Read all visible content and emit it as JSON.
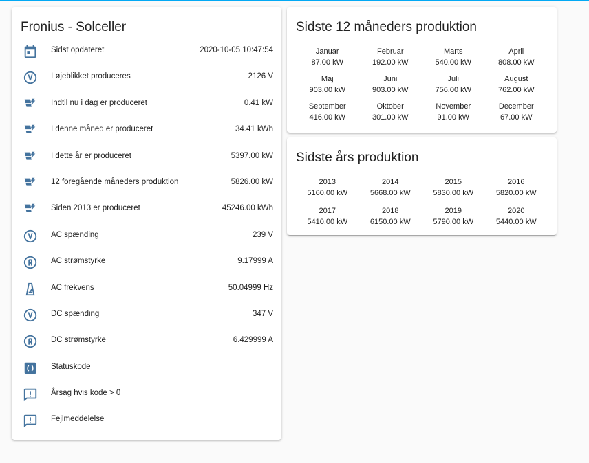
{
  "colors": {
    "icon": "#44739e",
    "accent": "#03a9f4",
    "background": "#fafafa",
    "card": "#ffffff"
  },
  "fronius": {
    "title": "Fronius - Solceller",
    "rows": [
      {
        "icon": "calendar-icon",
        "name": "Sidst opdateret",
        "state": "2020-10-05 10:47:54"
      },
      {
        "icon": "voltage-icon",
        "name": "I øjeblikket produceres",
        "state": "2126 V"
      },
      {
        "icon": "solar-power-icon",
        "name": "Indtil nu i dag er produceret",
        "state": "0.41 kW"
      },
      {
        "icon": "solar-power-icon",
        "name": "I denne måned er produceret",
        "state": "34.41 kWh"
      },
      {
        "icon": "solar-power-icon",
        "name": "I dette år er produceret",
        "state": "5397.00 kW"
      },
      {
        "icon": "solar-power-icon",
        "name": "12 foregående måneders produktion",
        "state": "5826.00 kW"
      },
      {
        "icon": "solar-power-icon",
        "name": "Siden 2013 er produceret",
        "state": "45246.00 kWh"
      },
      {
        "icon": "voltage-icon",
        "name": "AC spænding",
        "state": "239 V"
      },
      {
        "icon": "current-icon",
        "name": "AC strømstyrke",
        "state": "9.17999 A"
      },
      {
        "icon": "metronome-icon",
        "name": "AC frekvens",
        "state": "50.04999 Hz"
      },
      {
        "icon": "voltage-icon",
        "name": "DC spænding",
        "state": "347 V"
      },
      {
        "icon": "current-icon",
        "name": "DC strømstyrke",
        "state": "6.429999 A"
      },
      {
        "icon": "code-parentheses-icon",
        "name": "Statuskode",
        "state": ""
      },
      {
        "icon": "alert-message-icon",
        "name": "Årsag hvis kode > 0",
        "state": ""
      },
      {
        "icon": "alert-message-icon",
        "name": "Fejlmeddelelse",
        "state": ""
      }
    ]
  },
  "months": {
    "title": "Sidste 12 måneders produktion",
    "items": [
      {
        "label": "Januar",
        "value": "87.00 kW"
      },
      {
        "label": "Februar",
        "value": "192.00 kW"
      },
      {
        "label": "Marts",
        "value": "540.00 kW"
      },
      {
        "label": "April",
        "value": "808.00 kW"
      },
      {
        "label": "Maj",
        "value": "903.00 kW"
      },
      {
        "label": "Juni",
        "value": "903.00 kW"
      },
      {
        "label": "Juli",
        "value": "756.00 kW"
      },
      {
        "label": "August",
        "value": "762.00 kW"
      },
      {
        "label": "September",
        "value": "416.00 kW"
      },
      {
        "label": "Oktober",
        "value": "301.00 kW"
      },
      {
        "label": "November",
        "value": "91.00 kW"
      },
      {
        "label": "December",
        "value": "67.00 kW"
      }
    ]
  },
  "years": {
    "title": "Sidste års produktion",
    "items": [
      {
        "label": "2013",
        "value": "5160.00 kW"
      },
      {
        "label": "2014",
        "value": "5668.00 kW"
      },
      {
        "label": "2015",
        "value": "5830.00 kW"
      },
      {
        "label": "2016",
        "value": "5820.00 kW"
      },
      {
        "label": "2017",
        "value": "5410.00 kW"
      },
      {
        "label": "2018",
        "value": "6150.00 kW"
      },
      {
        "label": "2019",
        "value": "5790.00 kW"
      },
      {
        "label": "2020",
        "value": "5440.00 kW"
      }
    ]
  }
}
